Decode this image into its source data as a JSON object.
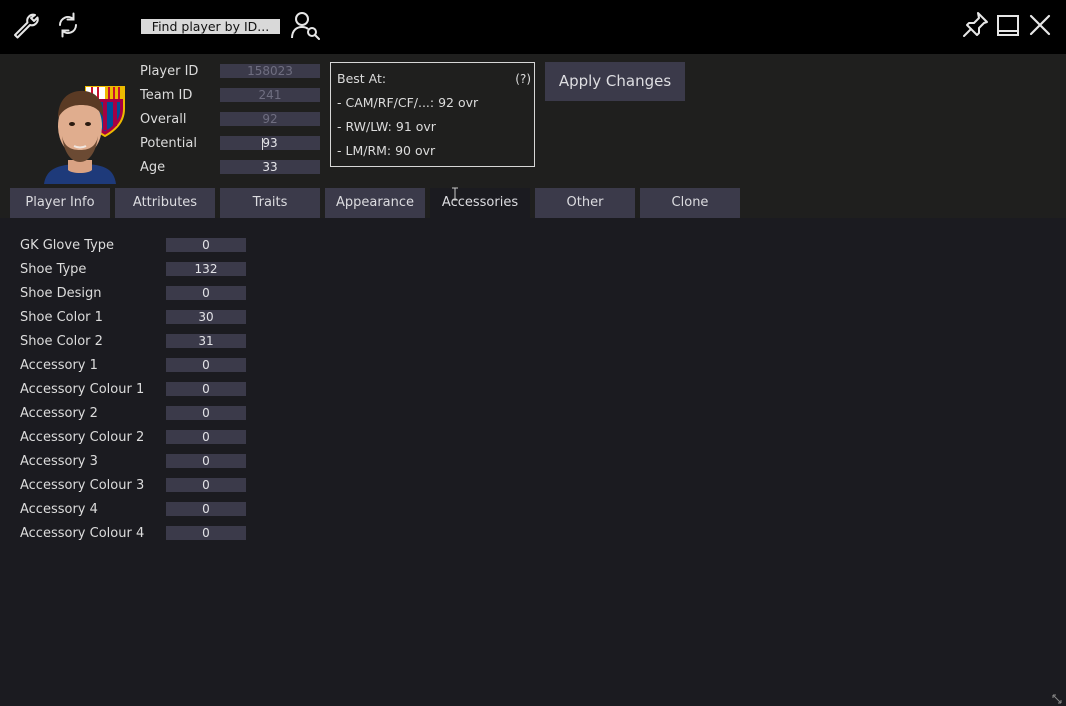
{
  "toolbar": {
    "find_label": "Find player by ID..."
  },
  "player": {
    "labels": {
      "player_id": "Player ID",
      "team_id": "Team ID",
      "overall": "Overall",
      "potential": "Potential",
      "age": "Age"
    },
    "values": {
      "player_id": "158023",
      "team_id": "241",
      "overall": "92",
      "potential": "93",
      "age": "33"
    }
  },
  "best_at": {
    "title": "Best At:",
    "help": "(?)",
    "lines": [
      "- CAM/RF/CF/...: 92 ovr",
      "- RW/LW: 91 ovr",
      "- LM/RM: 90 ovr"
    ]
  },
  "apply_label": "Apply Changes",
  "tabs": [
    {
      "label": "Player Info"
    },
    {
      "label": "Attributes"
    },
    {
      "label": "Traits"
    },
    {
      "label": "Appearance"
    },
    {
      "label": "Accessories",
      "active": true
    },
    {
      "label": "Other"
    },
    {
      "label": "Clone"
    }
  ],
  "accessories": [
    {
      "label": "GK Glove Type",
      "value": "0"
    },
    {
      "label": "Shoe Type",
      "value": "132"
    },
    {
      "label": "Shoe Design",
      "value": "0"
    },
    {
      "label": "Shoe Color 1",
      "value": "30"
    },
    {
      "label": "Shoe Color 2",
      "value": "31"
    },
    {
      "label": "Accessory 1",
      "value": "0"
    },
    {
      "label": "Accessory Colour 1",
      "value": "0"
    },
    {
      "label": "Accessory 2",
      "value": "0"
    },
    {
      "label": "Accessory Colour 2",
      "value": "0"
    },
    {
      "label": "Accessory 3",
      "value": "0"
    },
    {
      "label": "Accessory Colour 3",
      "value": "0"
    },
    {
      "label": "Accessory 4",
      "value": "0"
    },
    {
      "label": "Accessory Colour 4",
      "value": "0"
    }
  ],
  "colors": {
    "background": "#1b1b20",
    "input": "#3b3a4a",
    "topbar": "#000000"
  }
}
